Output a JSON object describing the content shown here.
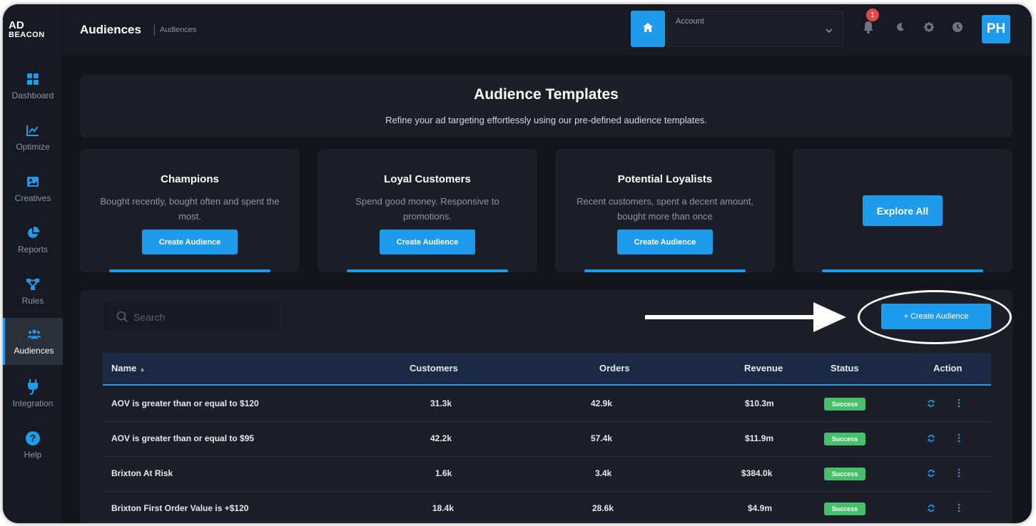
{
  "app": {
    "logo_line1": "AD",
    "logo_line2": "BEACON"
  },
  "sidebar": {
    "items": [
      {
        "label": "Dashboard",
        "icon": "grid-icon"
      },
      {
        "label": "Optimize",
        "icon": "trend-chart-icon"
      },
      {
        "label": "Creatives",
        "icon": "image-icon"
      },
      {
        "label": "Reports",
        "icon": "pie-chart-icon"
      },
      {
        "label": "Rules",
        "icon": "flow-icon"
      },
      {
        "label": "Audiences",
        "icon": "users-icon",
        "active": true
      },
      {
        "label": "Integration",
        "icon": "plug-icon"
      },
      {
        "label": "Help",
        "icon": "help-icon"
      }
    ]
  },
  "topbar": {
    "title": "Audiences",
    "breadcrumb": "Audiences",
    "account_label": "Account",
    "notification_count": "1",
    "avatar_initials": "PH"
  },
  "templates": {
    "title": "Audience Templates",
    "subtitle": "Refine your ad targeting effortlessly using our pre-defined audience templates.",
    "cards": [
      {
        "title": "Champions",
        "desc": "Bought recently, bought often and spent the most.",
        "button": "Create Audience"
      },
      {
        "title": "Loyal Customers",
        "desc": "Spend good money. Responsive to promotions.",
        "button": "Create Audience"
      },
      {
        "title": "Potential Loyalists",
        "desc": "Recent customers, spent a decent amount, bought more than once",
        "button": "Create Audience"
      }
    ],
    "explore_button": "Explore All"
  },
  "list": {
    "search_placeholder": "Search",
    "create_button": "+ Create Audience",
    "columns": [
      "Name",
      "Customers",
      "Orders",
      "Revenue",
      "Status",
      "Action"
    ],
    "rows": [
      {
        "name": "AOV is greater than or equal to $120",
        "customers": "31.3k",
        "orders": "42.9k",
        "revenue": "$10.3m",
        "status": "Success"
      },
      {
        "name": "AOV is greater than or equal to $95",
        "customers": "42.2k",
        "orders": "57.4k",
        "revenue": "$11.9m",
        "status": "Success"
      },
      {
        "name": "Brixton At Risk",
        "customers": "1.6k",
        "orders": "3.4k",
        "revenue": "$384.0k",
        "status": "Success"
      },
      {
        "name": "Brixton First Order Value is +$120",
        "customers": "18.4k",
        "orders": "28.6k",
        "revenue": "$4.9m",
        "status": "Success"
      }
    ]
  },
  "colors": {
    "accent": "#1e9bea",
    "success": "#46c06a",
    "background": "#13151c",
    "panel": "#1c1f28",
    "badge": "#e24848"
  }
}
